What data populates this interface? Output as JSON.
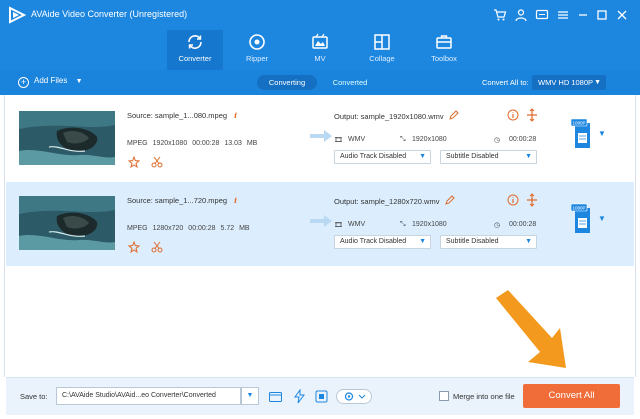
{
  "window": {
    "title": "AVAide Video Converter (Unregistered)"
  },
  "nav": [
    {
      "label": "Converter",
      "icon": "converter-icon",
      "active": true
    },
    {
      "label": "Ripper",
      "icon": "ripper-icon",
      "active": false
    },
    {
      "label": "MV",
      "icon": "mv-icon",
      "active": false
    },
    {
      "label": "Collage",
      "icon": "collage-icon",
      "active": false
    },
    {
      "label": "Toolbox",
      "icon": "toolbox-icon",
      "active": false
    }
  ],
  "toolbar": {
    "add_files": "Add Files",
    "tab_converting": "Converting",
    "tab_converted": "Converted",
    "convert_all_to_label": "Convert All to:",
    "convert_all_to_value": "WMV HD 1080P"
  },
  "files": [
    {
      "source": "Source: sample_1...080.mpeg",
      "format": "MPEG",
      "resolution": "1920x1080",
      "duration": "00:00:28",
      "size": "13.03 MB",
      "output": "Output: sample_1920x1080.wmv",
      "out_format": "WMV",
      "out_resolution": "1920x1080",
      "out_duration": "00:00:28",
      "audio_track": "Audio Track Disabled",
      "subtitle": "Subtitle Disabled",
      "badge": "1080P"
    },
    {
      "source": "Source: sample_1...720.mpeg",
      "format": "MPEG",
      "resolution": "1280x720",
      "duration": "00:00:28",
      "size": "5.72 MB",
      "output": "Output: sample_1280x720.wmv",
      "out_format": "WMV",
      "out_resolution": "1920x1080",
      "out_duration": "00:00:28",
      "audio_track": "Audio Track Disabled",
      "subtitle": "Subtitle Disabled",
      "badge": "1080P"
    }
  ],
  "bottom": {
    "save_to_label": "Save to:",
    "save_path": "C:\\AVAide Studio\\AVAid...eo Converter\\Converted",
    "merge_label": "Merge into one file",
    "convert_all": "Convert All"
  },
  "colors": {
    "brand_blue": "#1d87e0",
    "row_highlight": "#dceefe",
    "convert_orange": "#f06c39",
    "pointer_orange": "#f39a1e"
  }
}
